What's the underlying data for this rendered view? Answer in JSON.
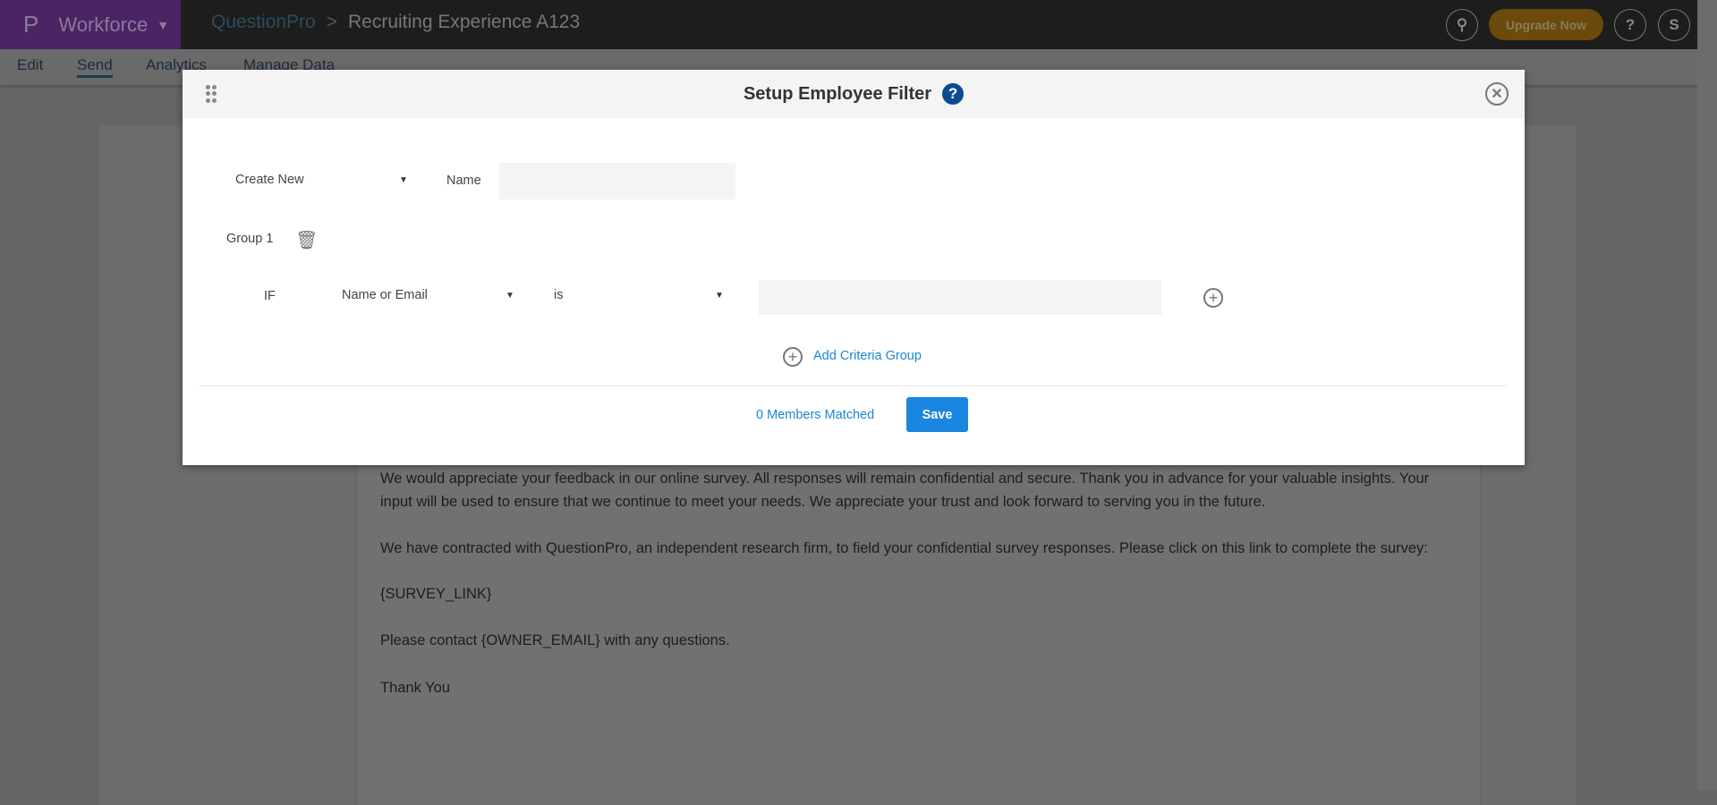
{
  "topbar": {
    "logo": "P",
    "product": "Workforce",
    "breadcrumb_root": "QuestionPro",
    "breadcrumb_sep": ">",
    "survey_title": "Recruiting Experience A123",
    "upgrade": "Upgrade Now",
    "help": "?",
    "avatar": "S"
  },
  "nav": {
    "items": [
      "Edit",
      "Send",
      "Analytics",
      "Manage Data"
    ],
    "active": "Send"
  },
  "email_body": [
    "We would appreciate your feedback in our online survey. All responses will remain confidential and secure. Thank you in advance for your valuable insights. Your input will be used to ensure that we continue to meet your needs. We appreciate your trust and look forward to serving you in the future.",
    "We have contracted with QuestionPro, an independent research firm, to field your confidential survey responses. Please click on this link to complete the survey:",
    "{SURVEY_LINK}",
    "Please contact {OWNER_EMAIL} with any questions.",
    "Thank You"
  ],
  "modal": {
    "title": "Setup Employee Filter",
    "help": "?",
    "filter_select": "Create New",
    "name_label": "Name",
    "name_value": "",
    "group_label": "Group 1",
    "if_label": "IF",
    "field_select": "Name or Email",
    "operator_select": "is",
    "criteria_value": "",
    "add_group": "Add Criteria Group",
    "matched": "0 Members Matched",
    "save": "Save"
  },
  "colors": {
    "accent": "#1a86e0",
    "brand": "#4b2466",
    "upgrade": "#6b4a0c"
  }
}
